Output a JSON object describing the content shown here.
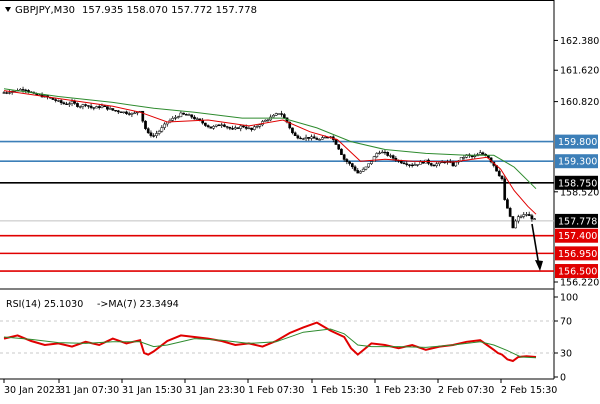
{
  "header": {
    "symbol": "GBPJPY,M30",
    "ohlc": "157.935 158.070 157.772 157.778"
  },
  "chart_data": [
    {
      "type": "candlestick",
      "title": "GBPJPY,M30",
      "ohlc": {
        "open": 157.935,
        "high": 158.07,
        "low": 157.772,
        "close": 157.778
      },
      "ylim": [
        156.22,
        162.85
      ],
      "y_ticks": [
        "162.380",
        "161.620",
        "160.820",
        "158.520",
        "156.220"
      ],
      "last_price": "157.778",
      "levels": [
        {
          "label": "159.800",
          "value": 159.8,
          "color": "#3c7fb8",
          "kind": "resistance"
        },
        {
          "label": "159.300",
          "value": 159.3,
          "color": "#3c7fb8",
          "kind": "resistance"
        },
        {
          "label": "158.750",
          "value": 158.75,
          "color": "#000000",
          "kind": "pivot"
        },
        {
          "label": "157.400",
          "value": 157.4,
          "color": "#e00000",
          "kind": "support"
        },
        {
          "label": "156.950",
          "value": 156.95,
          "color": "#e00000",
          "kind": "support"
        },
        {
          "label": "156.500",
          "value": 156.5,
          "color": "#e00000",
          "kind": "support"
        }
      ],
      "arrow": {
        "from": 157.7,
        "to": 156.5,
        "direction": "down"
      },
      "x_labels": [
        "30 Jan 2023",
        "31 Jan 07:30",
        "31 Jan 15:30",
        "31 Jan 23:30",
        "1 Feb 07:30",
        "1 Feb 15:30",
        "1 Feb 23:30",
        "2 Feb 07:30",
        "2 Feb 15:30"
      ],
      "close_path": [
        [
          0,
          161.05
        ],
        [
          8,
          161.1
        ],
        [
          15,
          161.15
        ],
        [
          22,
          161.0
        ],
        [
          30,
          160.95
        ],
        [
          38,
          160.85
        ],
        [
          45,
          160.75
        ],
        [
          50,
          160.8
        ],
        [
          55,
          160.7
        ],
        [
          60,
          160.75
        ],
        [
          65,
          160.65
        ],
        [
          72,
          160.7
        ],
        [
          80,
          160.6
        ],
        [
          88,
          160.55
        ],
        [
          95,
          160.5
        ],
        [
          100,
          160.6
        ],
        [
          103,
          160.2
        ],
        [
          106,
          160.0
        ],
        [
          110,
          159.95
        ],
        [
          115,
          160.1
        ],
        [
          120,
          160.3
        ],
        [
          125,
          160.4
        ],
        [
          130,
          160.5
        ],
        [
          137,
          160.45
        ],
        [
          145,
          160.3
        ],
        [
          152,
          160.15
        ],
        [
          160,
          160.25
        ],
        [
          168,
          160.1
        ],
        [
          175,
          160.2
        ],
        [
          182,
          160.1
        ],
        [
          190,
          160.3
        ],
        [
          198,
          160.45
        ],
        [
          203,
          160.55
        ],
        [
          208,
          160.3
        ],
        [
          213,
          159.95
        ],
        [
          218,
          159.9
        ],
        [
          225,
          159.9
        ],
        [
          232,
          159.85
        ],
        [
          240,
          159.95
        ],
        [
          245,
          159.7
        ],
        [
          250,
          159.35
        ],
        [
          255,
          159.2
        ],
        [
          260,
          159.0
        ],
        [
          265,
          159.1
        ],
        [
          270,
          159.3
        ],
        [
          275,
          159.55
        ],
        [
          280,
          159.5
        ],
        [
          285,
          159.4
        ],
        [
          290,
          159.3
        ],
        [
          295,
          159.25
        ],
        [
          300,
          159.2
        ],
        [
          305,
          159.25
        ],
        [
          310,
          159.3
        ],
        [
          315,
          159.2
        ],
        [
          320,
          159.25
        ],
        [
          325,
          159.3
        ],
        [
          330,
          159.2
        ],
        [
          335,
          159.35
        ],
        [
          340,
          159.45
        ],
        [
          345,
          159.4
        ],
        [
          350,
          159.5
        ],
        [
          355,
          159.45
        ],
        [
          360,
          159.2
        ],
        [
          363,
          159.0
        ],
        [
          366,
          158.85
        ],
        [
          368,
          158.3
        ],
        [
          371,
          158.0
        ],
        [
          374,
          157.6
        ],
        [
          377,
          157.85
        ],
        [
          380,
          157.9
        ],
        [
          384,
          157.95
        ],
        [
          388,
          157.85
        ],
        [
          391,
          157.78
        ]
      ],
      "ma_red": [
        [
          0,
          161.1
        ],
        [
          40,
          160.9
        ],
        [
          80,
          160.7
        ],
        [
          100,
          160.55
        ],
        [
          120,
          160.3
        ],
        [
          150,
          160.35
        ],
        [
          180,
          160.2
        ],
        [
          205,
          160.35
        ],
        [
          225,
          160.05
        ],
        [
          245,
          159.85
        ],
        [
          262,
          159.3
        ],
        [
          280,
          159.35
        ],
        [
          300,
          159.3
        ],
        [
          330,
          159.28
        ],
        [
          355,
          159.4
        ],
        [
          365,
          159.1
        ],
        [
          375,
          158.55
        ],
        [
          385,
          158.15
        ],
        [
          391,
          157.95
        ]
      ],
      "ma_green": [
        [
          0,
          161.15
        ],
        [
          40,
          160.95
        ],
        [
          80,
          160.8
        ],
        [
          110,
          160.65
        ],
        [
          140,
          160.55
        ],
        [
          175,
          160.4
        ],
        [
          205,
          160.4
        ],
        [
          230,
          160.15
        ],
        [
          255,
          159.8
        ],
        [
          280,
          159.6
        ],
        [
          310,
          159.5
        ],
        [
          340,
          159.45
        ],
        [
          360,
          159.45
        ],
        [
          375,
          159.15
        ],
        [
          391,
          158.6
        ]
      ]
    },
    {
      "type": "line",
      "title": "RSI(14) 25.1030 ->MA(7) 23.3494",
      "rsi_label": "RSI(14) 25.1030",
      "ma_label": "->MA(7) 23.3494",
      "ylim": [
        0,
        100
      ],
      "y_ticks": [
        "100",
        "70",
        "30",
        "0"
      ],
      "levels": [
        70,
        30
      ],
      "series": [
        {
          "name": "RSI(14)",
          "color": "#e00000",
          "x": [
            0,
            10,
            20,
            30,
            40,
            50,
            60,
            70,
            80,
            90,
            100,
            103,
            106,
            110,
            120,
            130,
            140,
            150,
            160,
            170,
            180,
            190,
            200,
            210,
            220,
            230,
            240,
            250,
            255,
            260,
            265,
            270,
            280,
            290,
            300,
            310,
            320,
            330,
            340,
            350,
            355,
            360,
            363,
            366,
            370,
            374,
            378,
            384,
            391
          ],
          "values": [
            48,
            52,
            45,
            40,
            42,
            38,
            44,
            40,
            48,
            42,
            46,
            30,
            28,
            32,
            45,
            52,
            50,
            48,
            45,
            40,
            42,
            38,
            45,
            55,
            62,
            68,
            58,
            50,
            36,
            28,
            35,
            42,
            40,
            36,
            40,
            34,
            38,
            40,
            44,
            46,
            40,
            34,
            30,
            28,
            22,
            20,
            25,
            26,
            25
          ]
        },
        {
          "name": "MA(7)",
          "color": "#2e8b2e",
          "x": [
            0,
            20,
            40,
            60,
            80,
            100,
            110,
            120,
            140,
            160,
            180,
            200,
            220,
            240,
            250,
            260,
            270,
            290,
            310,
            330,
            350,
            360,
            370,
            380,
            391
          ],
          "values": [
            50,
            47,
            43,
            42,
            44,
            44,
            38,
            40,
            48,
            46,
            42,
            44,
            56,
            60,
            54,
            40,
            38,
            38,
            37,
            40,
            44,
            40,
            33,
            25,
            24
          ]
        }
      ]
    }
  ]
}
